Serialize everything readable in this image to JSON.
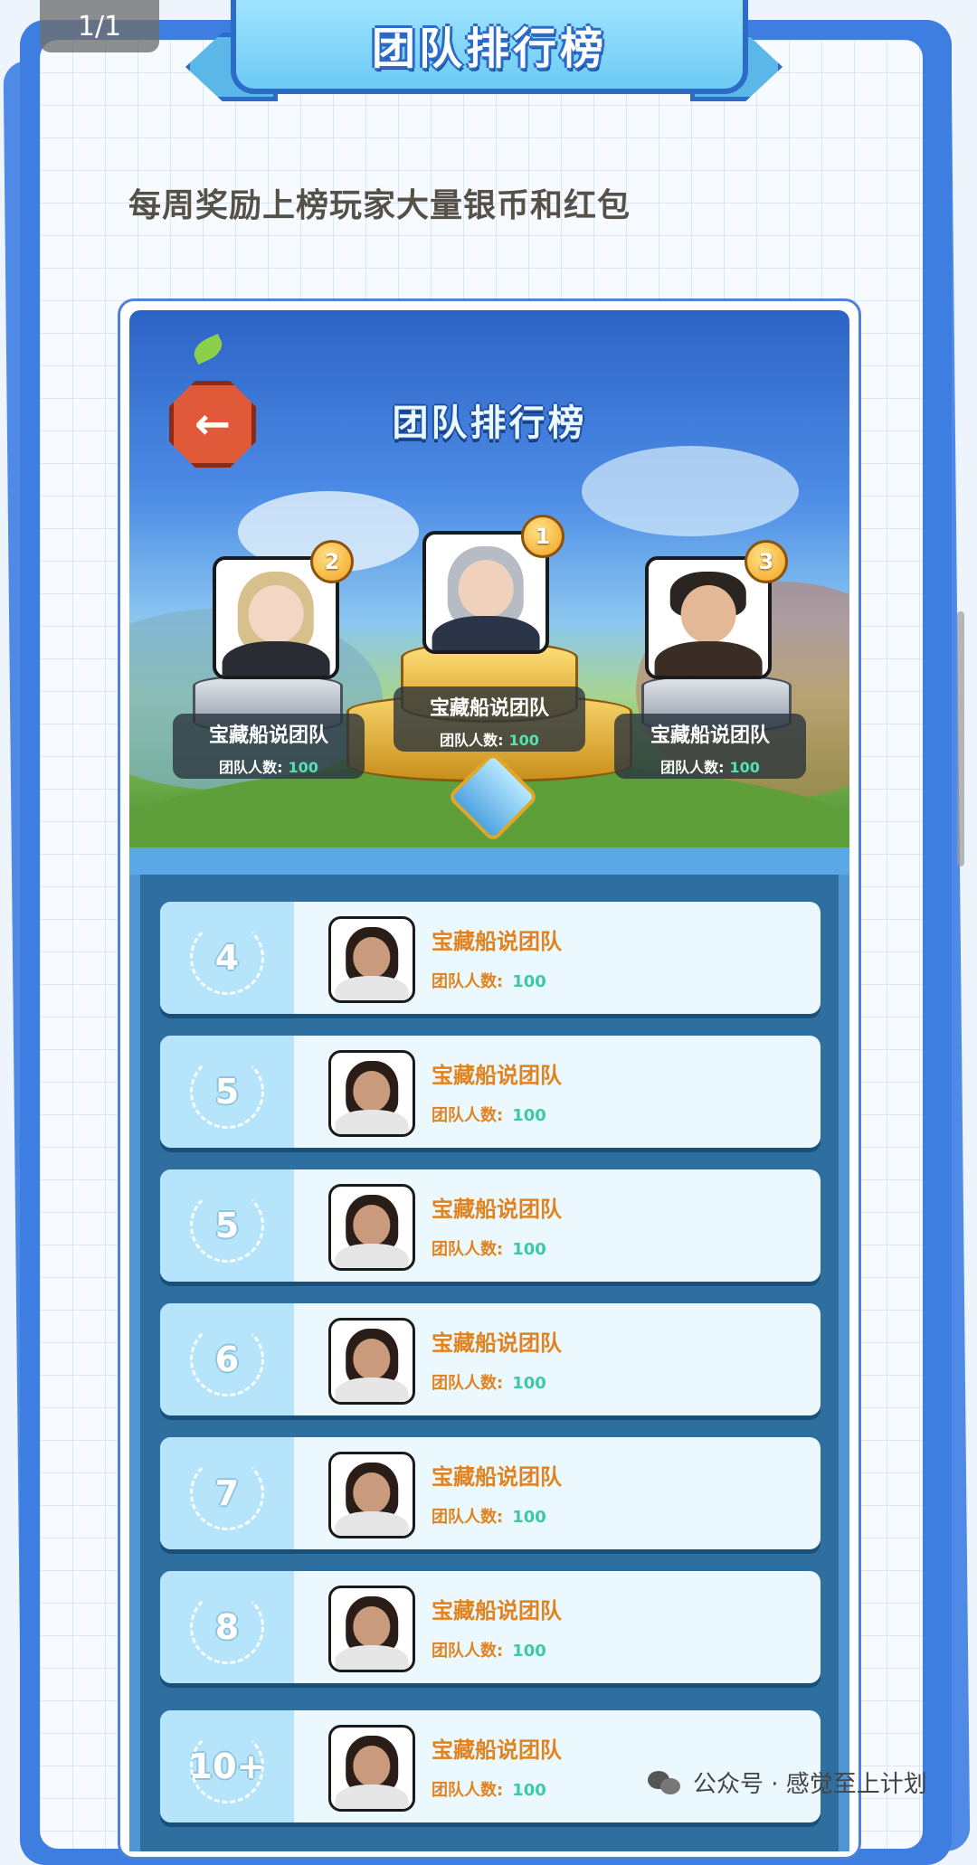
{
  "viewer": {
    "page_counter": "1/1"
  },
  "header": {
    "title": "团队排行榜"
  },
  "subtitle": "每周奖励上榜玩家大量银币和红包",
  "game": {
    "title": "团队排行榜",
    "back_icon": "arrow-left-icon",
    "podium": [
      {
        "rank": "1",
        "team_name": "宝藏船说团队",
        "count_label": "团队人数:",
        "count": "100"
      },
      {
        "rank": "2",
        "team_name": "宝藏船说团队",
        "count_label": "团队人数:",
        "count": "100"
      },
      {
        "rank": "3",
        "team_name": "宝藏船说团队",
        "count_label": "团队人数:",
        "count": "100"
      }
    ],
    "list": [
      {
        "rank": "4",
        "team_name": "宝藏船说团队",
        "count_label": "团队人数:",
        "count": "100"
      },
      {
        "rank": "5",
        "team_name": "宝藏船说团队",
        "count_label": "团队人数:",
        "count": "100"
      },
      {
        "rank": "5",
        "team_name": "宝藏船说团队",
        "count_label": "团队人数:",
        "count": "100"
      },
      {
        "rank": "6",
        "team_name": "宝藏船说团队",
        "count_label": "团队人数:",
        "count": "100"
      },
      {
        "rank": "7",
        "team_name": "宝藏船说团队",
        "count_label": "团队人数:",
        "count": "100"
      },
      {
        "rank": "8",
        "team_name": "宝藏船说团队",
        "count_label": "团队人数:",
        "count": "100"
      },
      {
        "rank": "10+",
        "team_name": "宝藏船说团队",
        "count_label": "团队人数:",
        "count": "100"
      }
    ]
  },
  "watermark": "公众号 · 感觉至上计划",
  "colors": {
    "frame": "#3d7ee0",
    "accent_orange": "#e0821e",
    "count_green": "#3cc9a7",
    "gold": "#f2a11c"
  }
}
